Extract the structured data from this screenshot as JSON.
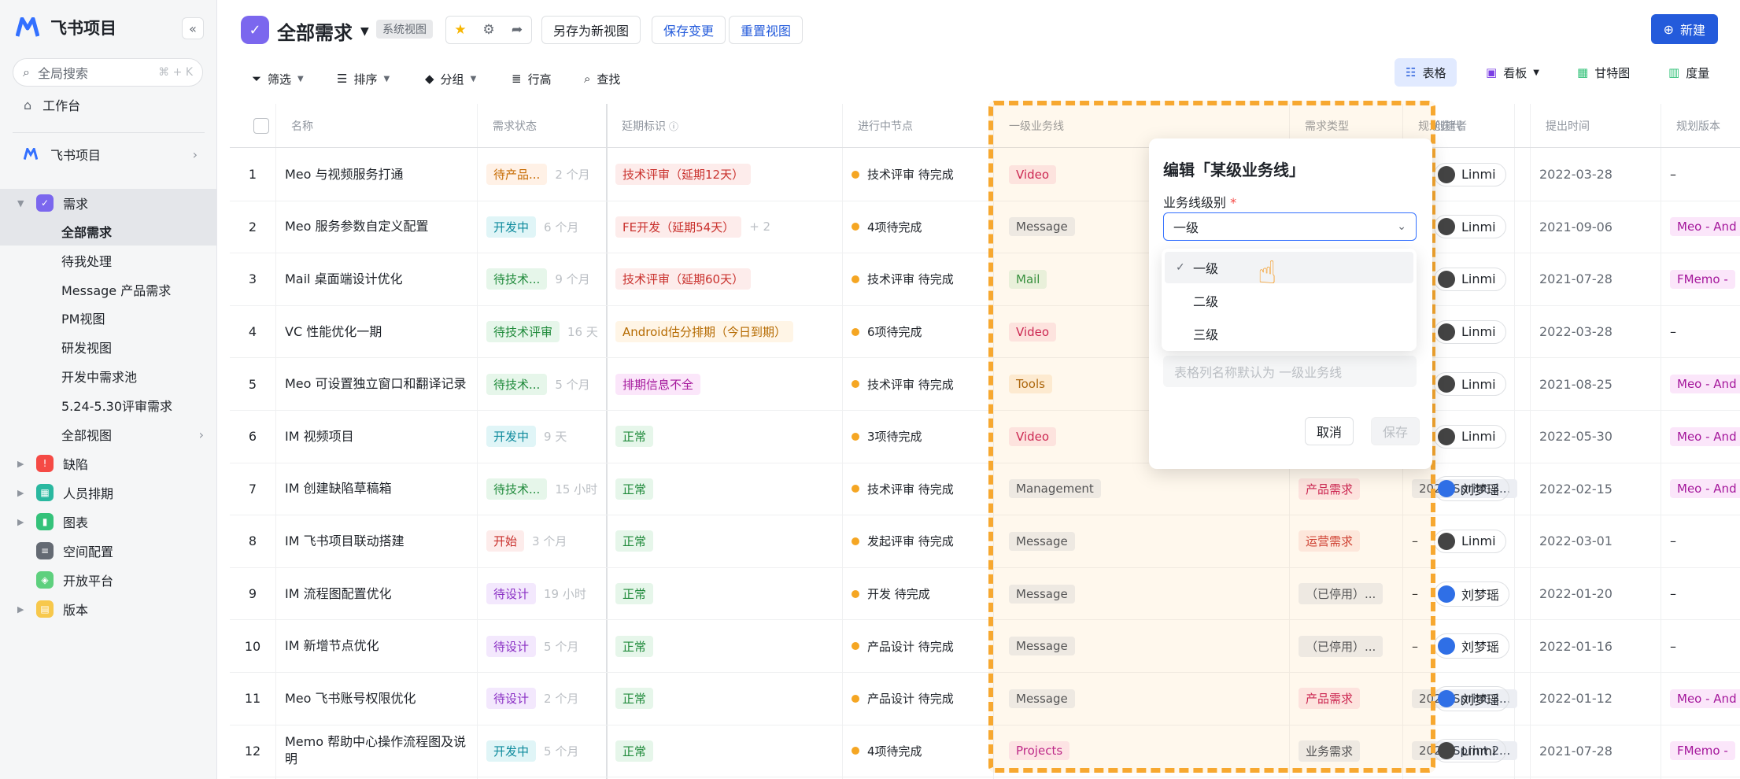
{
  "sidebar": {
    "app_name": "飞书项目",
    "search_placeholder": "全局搜索",
    "search_shortcut": "⌘ + K",
    "workbench": "工作台",
    "project": "飞书项目",
    "items": [
      {
        "label": "需求",
        "color": "#7b67ee"
      },
      {
        "label": "缺陷",
        "color": "#f54a45"
      },
      {
        "label": "人员排期",
        "color": "#2ab8a0"
      },
      {
        "label": "图表",
        "color": "#34c27a"
      },
      {
        "label": "空间配置",
        "color": "#646a73"
      },
      {
        "label": "开放平台",
        "color": "#5ed07e"
      },
      {
        "label": "版本",
        "color": "#f7c84c"
      }
    ],
    "sub_items": [
      "全部需求",
      "待我处理",
      "Message 产品需求",
      "PM视图",
      "研发视图",
      "开发中需求池",
      "5.24-5.30评审需求",
      "全部视图"
    ]
  },
  "header": {
    "title": "全部需求",
    "tag": "系统视图",
    "save_as": "另存为新视图",
    "save_changes": "保存变更",
    "reset_view": "重置视图",
    "new_button": "新建"
  },
  "toolbar": {
    "filter": "筛选",
    "sort": "排序",
    "group": "分组",
    "row_height": "行高",
    "find": "查找",
    "views": [
      "表格",
      "看板",
      "甘特图",
      "度量"
    ]
  },
  "columns": [
    "名称",
    "需求状态",
    "延期标识",
    "进行中节点",
    "一级业务线",
    "需求类型",
    "规划迭代",
    "创建者",
    "提出时间",
    "规划版本"
  ],
  "rows": [
    {
      "no": "1",
      "name": "Meo 与视频服务打通",
      "status": "待产品...",
      "status_time": "2 个月",
      "delay": "技术评审（延期12天）",
      "delay_extra": "",
      "node": "技术评审 待完成",
      "biz": "Video",
      "type": "",
      "iter": "",
      "creator": "Linmi",
      "date": "2022-03-28",
      "version": "–"
    },
    {
      "no": "2",
      "name": "Meo 服务参数自定义配置",
      "status": "开发中",
      "status_time": "6 个月",
      "delay": "FE开发（延期54天）",
      "delay_extra": "+ 2",
      "node": "4项待完成",
      "biz": "Message",
      "type": "",
      "iter": "",
      "creator": "Linmi",
      "date": "2021-09-06",
      "version": "Meo - And"
    },
    {
      "no": "3",
      "name": "Mail 桌面端设计优化",
      "status": "待技术...",
      "status_time": "9 个月",
      "delay": "技术评审（延期60天）",
      "delay_extra": "",
      "node": "技术评审 待完成",
      "biz": "Mail",
      "type": "",
      "iter": "",
      "creator": "Linmi",
      "date": "2021-07-28",
      "version": "FMemo -"
    },
    {
      "no": "4",
      "name": "VC 性能优化一期",
      "status": "待技术评审",
      "status_time": "16 天",
      "delay": "Android估分排期（今日到期）",
      "delay_extra": "",
      "node": "6项待完成",
      "biz": "Video",
      "type": "",
      "iter": "",
      "creator": "Linmi",
      "date": "2022-03-28",
      "version": "–"
    },
    {
      "no": "5",
      "name": "Meo 可设置独立窗口和翻译记录",
      "status": "待技术...",
      "status_time": "5 个月",
      "delay": "排期信息不全",
      "delay_extra": "",
      "node": "技术评审 待完成",
      "biz": "Tools",
      "type": "",
      "iter": "",
      "creator": "Linmi",
      "date": "2021-08-25",
      "version": "Meo - And"
    },
    {
      "no": "6",
      "name": "IM 视频项目",
      "status": "开发中",
      "status_time": "9 天",
      "delay": "正常",
      "delay_extra": "",
      "node": "3项待完成",
      "biz": "Video",
      "type": "",
      "iter": "",
      "creator": "Linmi",
      "date": "2022-05-30",
      "version": "Meo - And"
    },
    {
      "no": "7",
      "name": "IM 创建缺陷草稿箱",
      "status": "待技术...",
      "status_time": "15 小时",
      "delay": "正常",
      "delay_extra": "",
      "node": "技术评审 待完成",
      "biz": "Management",
      "type": "产品需求",
      "iter": "2021 Sprint 3...",
      "creator": "刘梦瑶",
      "date": "2022-02-15",
      "version": "Meo - And"
    },
    {
      "no": "8",
      "name": "IM 飞书项目联动搭建",
      "status": "开始",
      "status_time": "3 个月",
      "delay": "正常",
      "delay_extra": "",
      "node": "发起评审 待完成",
      "biz": "Message",
      "type": "运营需求",
      "iter": "–",
      "creator": "Linmi",
      "date": "2022-03-01",
      "version": "–"
    },
    {
      "no": "9",
      "name": "IM 流程图配置优化",
      "status": "待设计",
      "status_time": "19 小时",
      "delay": "正常",
      "delay_extra": "",
      "node": "开发 待完成",
      "biz": "Message",
      "type": "（已停用）...",
      "iter": "–",
      "creator": "刘梦瑶",
      "date": "2022-01-20",
      "version": "–"
    },
    {
      "no": "10",
      "name": "IM 新增节点优化",
      "status": "待设计",
      "status_time": "5 个月",
      "delay": "正常",
      "delay_extra": "",
      "node": "产品设计 待完成",
      "biz": "Message",
      "type": "（已停用）...",
      "iter": "–",
      "creator": "刘梦瑶",
      "date": "2022-01-16",
      "version": "–"
    },
    {
      "no": "11",
      "name": "Meo 飞书账号权限优化",
      "status": "待设计",
      "status_time": "2 个月",
      "delay": "正常",
      "delay_extra": "",
      "node": "产品设计 待完成",
      "biz": "Message",
      "type": "产品需求",
      "iter": "2021 Sprint 3...",
      "creator": "刘梦瑶",
      "date": "2022-01-12",
      "version": "Meo - And"
    },
    {
      "no": "12",
      "name": "Memo 帮助中心操作流程图及说明",
      "status": "开发中",
      "status_time": "5 个月",
      "delay": "正常",
      "delay_extra": "",
      "node": "4项待完成",
      "biz": "Projects",
      "type": "业务需求",
      "iter": "2021 Sprint 2...",
      "creator": "Linmi",
      "date": "2021-07-28",
      "version": "FMemo -"
    }
  ],
  "modal": {
    "title": "编辑「某级业务线」",
    "label": "业务线级别",
    "required": "*",
    "selected": "一级",
    "options": [
      "一级",
      "二级",
      "三级"
    ],
    "hint": "表格列名称默认为 一级业务线",
    "cancel": "取消",
    "save": "保存"
  }
}
